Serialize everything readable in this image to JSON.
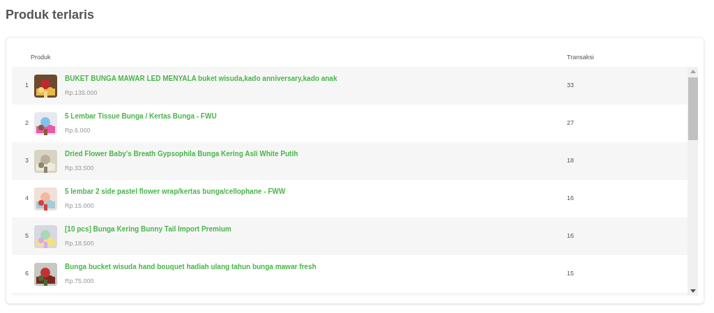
{
  "title": "Produk terlaris",
  "table": {
    "columns": [
      "Produk",
      "Transaksi"
    ],
    "rows": [
      {
        "rank": "1",
        "name": "BUKET BUNGA MAWAR LED MENYALA buket wisuda,kado anniversary,kado anak",
        "price": "Rp.135.000",
        "transactions": "33"
      },
      {
        "rank": "2",
        "name": "5 Lembar Tissue Bunga / Kertas Bunga - FWU",
        "price": "Rp.6.000",
        "transactions": "27"
      },
      {
        "rank": "3",
        "name": "Dried Flower Baby's Breath Gypsophila Bunga Kering Asli White Putih",
        "price": "Rp.33.500",
        "transactions": "18"
      },
      {
        "rank": "4",
        "name": "5 lembar 2 side pastel flower wrap/kertas bunga/cellophane - FWW",
        "price": "Rp.15.000",
        "transactions": "16"
      },
      {
        "rank": "5",
        "name": "[10 pcs] Bunga Kering Bunny Tail Import Premium",
        "price": "Rp.18.500",
        "transactions": "16"
      },
      {
        "rank": "6",
        "name": "Bunga bucket wisuda hand bouquet hadiah ulang tahun bunga mawar fresh",
        "price": "Rp.75.000",
        "transactions": "15"
      }
    ]
  }
}
